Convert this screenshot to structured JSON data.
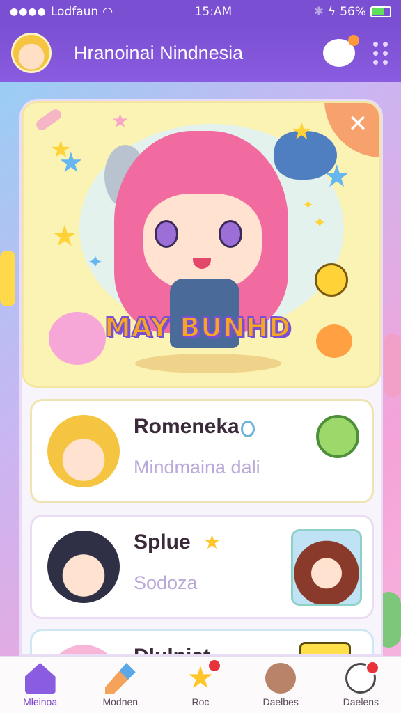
{
  "status_bar": {
    "carrier": "Lodfaun",
    "time": "15:AM",
    "battery": "56%"
  },
  "header": {
    "title": "Hranoinai Nindnesia"
  },
  "hero": {
    "title": "MAY BUNHD"
  },
  "list": [
    {
      "name": "Romeneka",
      "subtitle": "Mindmaina dali"
    },
    {
      "name": "Splue",
      "subtitle": "Sodoza"
    },
    {
      "name": "Dlulnist",
      "subtitle": ""
    }
  ],
  "bottom_nav": [
    {
      "label": "Mleinoa",
      "active": true
    },
    {
      "label": "Modnen",
      "active": false
    },
    {
      "label": "Roc",
      "active": false
    },
    {
      "label": "Daelbes",
      "active": false
    },
    {
      "label": "Daelens",
      "active": false
    }
  ],
  "colors": {
    "primary": "#7b4fd1",
    "hero_bg": "#fbf3b4",
    "notification": "#e8323a"
  }
}
